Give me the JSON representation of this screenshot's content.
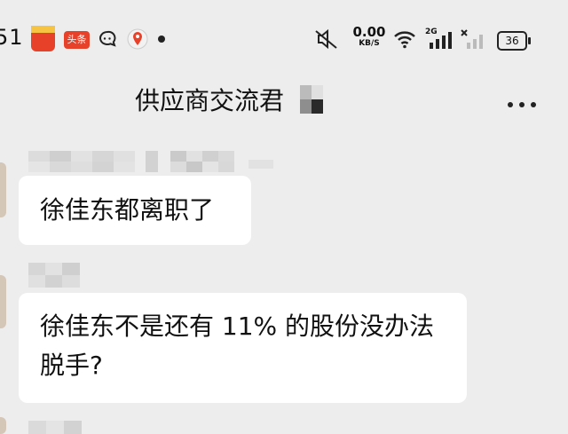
{
  "status_bar": {
    "time": "51",
    "apps": [
      {
        "icon": "calendar-app-icon",
        "label": "",
        "color": "#e8412a"
      },
      {
        "icon": "toutiao-app-icon",
        "label": "头条",
        "color": "#e8412a"
      },
      {
        "icon": "chat-bubble-icon"
      },
      {
        "icon": "map-pin-icon",
        "color": "#e8412a"
      }
    ],
    "net_speed_value": "0.00",
    "net_speed_unit": "KB/S",
    "network_type": "2G",
    "battery": "36"
  },
  "header": {
    "title": "供应商交流群",
    "title_visible": "供应商交流君"
  },
  "messages": [
    {
      "text": "徐佳东都离职了",
      "sender_hidden": true
    },
    {
      "text_line1": "徐佳东不是还有 11% 的股份没办法",
      "text_line2": "脱手?",
      "sender_hidden": true
    }
  ],
  "colors": {
    "background": "#ededed",
    "bubble": "#ffffff",
    "text": "#111111"
  }
}
